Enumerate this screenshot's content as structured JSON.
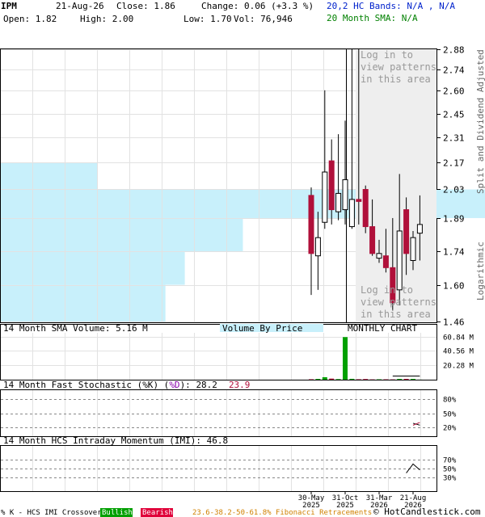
{
  "header": {
    "symbol": "IPM",
    "date": "21-Aug-26",
    "close": "Close: 1.86",
    "change": "Change: 0.06 (+3.3 %)",
    "open": "Open: 1.82",
    "high": "High: 2.00",
    "low": "Low: 1.70",
    "vol": "Vol: 76,946",
    "bands": "20,2 HC Bands: N/A , N/A",
    "sma": "20 Month SMA: N/A"
  },
  "colors": {
    "up": "#ffffff",
    "down": "#b0103a",
    "vbp": "#c8f0fb",
    "green": "#00a000",
    "purple": "#8800aa",
    "red": "#e0003a",
    "band_text": "#0022cc",
    "sma_text": "#008000"
  },
  "price_panel": {
    "login_text": [
      "Log in to",
      "view patterns",
      "in this area"
    ],
    "side_label": "Split and Dividend Adjusted",
    "scale_label": "Logarithmic"
  },
  "volume_panel": {
    "label": "14 Month SMA Volume: 5.16 M",
    "vbp_label": "Volume By Price",
    "chart_label": "MONTHLY CHART",
    "ticks": [
      "60.84 M",
      "40.56 M",
      "20.28 M"
    ]
  },
  "stoch_panel": {
    "label": "14 Month Fast Stochastic (%K) (%D): 28.2",
    "label_prefix": "14 Month Fast Stochastic (",
    "k_text": "%K",
    "mid": ") (",
    "d_text": "%D",
    "suffix": "): ",
    "k_value": "28.2",
    "d_value": "23.9",
    "ticks": [
      "80%",
      "50%",
      "20%"
    ]
  },
  "imi_panel": {
    "label": "14 Month HCS Intraday Momentum (IMI): 46.8",
    "ticks": [
      "70%",
      "50%",
      "30%"
    ]
  },
  "footer": {
    "prefix": "% K - HCS IMI Crossover,",
    "bullish": "Bullish",
    "bearish": "Bearish",
    "fib": "23.6-38.2-50-61.8% Fibonacci Retracements",
    "copyright": "© HotCandlestick.com"
  },
  "chart_data": {
    "type": "candlestick",
    "price_ticks": [
      2.88,
      2.74,
      2.6,
      2.45,
      2.31,
      2.17,
      2.03,
      1.89,
      1.74,
      1.6,
      1.46
    ],
    "price_range": [
      1.46,
      2.88
    ],
    "x_tick_labels": [
      [
        "30-May",
        "2025"
      ],
      [
        "31-Oct",
        "2025"
      ],
      [
        "31-Mar",
        "2026"
      ],
      [
        "21-Aug",
        "2026"
      ]
    ],
    "x_tick_months": [
      0,
      5,
      10,
      15
    ],
    "candles": [
      {
        "o": 2.0,
        "h": 2.04,
        "l": 1.56,
        "c": 1.73
      },
      {
        "o": 1.72,
        "h": 1.92,
        "l": 1.58,
        "c": 1.8
      },
      {
        "o": 1.87,
        "h": 2.6,
        "l": 1.84,
        "c": 2.12
      },
      {
        "o": 2.18,
        "h": 2.3,
        "l": 1.86,
        "c": 1.93
      },
      {
        "o": 1.92,
        "h": 2.33,
        "l": 1.88,
        "c": 2.01
      },
      {
        "o": 1.93,
        "h": 2.41,
        "l": 1.86,
        "c": 2.08
      },
      {
        "o": 1.85,
        "h": 2.88,
        "l": 1.84,
        "c": 1.98
      },
      {
        "o": 1.98,
        "h": 2.88,
        "l": 1.86,
        "c": 1.97
      },
      {
        "o": 2.03,
        "h": 2.05,
        "l": 1.82,
        "c": 1.85
      },
      {
        "o": 1.85,
        "h": 1.98,
        "l": 1.72,
        "c": 1.73
      },
      {
        "o": 1.71,
        "h": 1.79,
        "l": 1.69,
        "c": 1.73
      },
      {
        "o": 1.72,
        "h": 1.84,
        "l": 1.65,
        "c": 1.67
      },
      {
        "o": 1.67,
        "h": 1.89,
        "l": 1.5,
        "c": 1.53
      },
      {
        "o": 1.58,
        "h": 2.11,
        "l": 1.52,
        "c": 1.83
      },
      {
        "o": 1.93,
        "h": 1.99,
        "l": 1.64,
        "c": 1.73
      },
      {
        "o": 1.7,
        "h": 1.83,
        "l": 1.66,
        "c": 1.8
      },
      {
        "o": 1.82,
        "h": 2.0,
        "l": 1.7,
        "c": 1.86
      }
    ],
    "volume_m": [
      0.6,
      1.0,
      3.5,
      1.5,
      0.8,
      60.0,
      1.2,
      0.6,
      0.9,
      0.4,
      0.5,
      0.5,
      0.4,
      1.0,
      1.1,
      1.0,
      0.08
    ],
    "volume_sma_m": [
      5.16,
      5.16,
      5.16,
      5.16,
      5.16
    ],
    "volume_range_m": [
      0,
      66
    ],
    "vbp": [
      {
        "lo": 1.46,
        "hi": 1.6,
        "w": 0.34
      },
      {
        "lo": 1.6,
        "hi": 1.74,
        "w": 0.38
      },
      {
        "lo": 1.74,
        "hi": 1.89,
        "w": 0.5
      },
      {
        "lo": 1.89,
        "hi": 2.03,
        "w": 1.0
      },
      {
        "lo": 2.03,
        "hi": 2.17,
        "w": 0.2
      }
    ],
    "stoch_k": [
      28.2,
      24.0
    ],
    "stoch_d": [
      23.9,
      30.0
    ],
    "imi": [
      40.0,
      60.0,
      46.8
    ]
  }
}
